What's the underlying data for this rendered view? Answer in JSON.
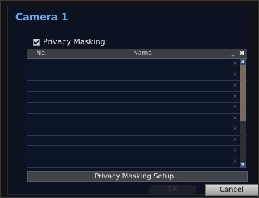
{
  "dialog": {
    "title": "Camera 1"
  },
  "privacy": {
    "checkbox_label": "Privacy Masking",
    "checked": true
  },
  "table": {
    "headers": {
      "no": "No.",
      "name": "Name",
      "minimize": "_",
      "close": "✖"
    },
    "row_count": 10,
    "delete_glyph": "✕"
  },
  "scroll": {
    "up": "▲",
    "down": "▼"
  },
  "buttons": {
    "setup": "Privacy Masking Setup...",
    "ok": "OK",
    "cancel": "Cancel"
  }
}
